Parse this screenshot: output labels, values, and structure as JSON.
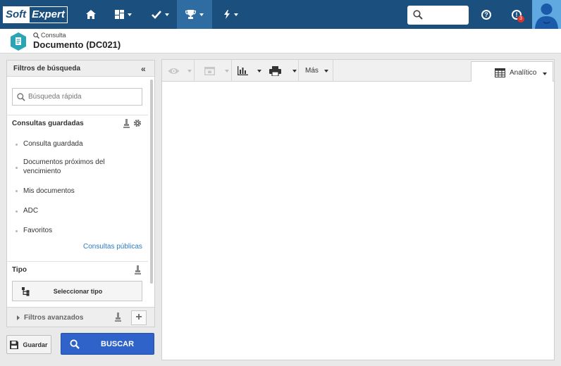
{
  "topbar": {
    "logo_part1": "Soft",
    "logo_part2": "Expert",
    "nav": [
      {
        "icon": "home-icon"
      },
      {
        "icon": "dashboard-icon"
      },
      {
        "icon": "check-icon"
      },
      {
        "icon": "trophy-icon",
        "active": true
      },
      {
        "icon": "lightning-icon"
      }
    ],
    "notification_count": "3",
    "colors": {
      "bar": "#1b4f7e",
      "active": "#2f6ca2",
      "badge": "#d9342b"
    }
  },
  "header": {
    "breadcrumb": "Consulta",
    "title": "Documento (DC021)",
    "badge_color": "#2aa5b5"
  },
  "filters": {
    "title": "Filtros de búsqueda",
    "quick_search_placeholder": "Búsqueda rápida",
    "saved_queries_title": "Consultas guardadas",
    "saved_queries": [
      "Consulta guardada",
      "Documentos próximos del vencimiento",
      "Mis documentos",
      "ADC",
      "Favoritos"
    ],
    "public_queries_link": "Consultas públicas",
    "type_title": "Tipo",
    "select_type_label": "Seleccionar tipo",
    "advanced_filters_label": "Filtros avanzados"
  },
  "actions": {
    "save_label": "Guardar",
    "search_label": "BUSCAR",
    "search_color": "#2f63c9"
  },
  "toolbar": {
    "more_label": "Más",
    "view_label": "Analítico"
  }
}
